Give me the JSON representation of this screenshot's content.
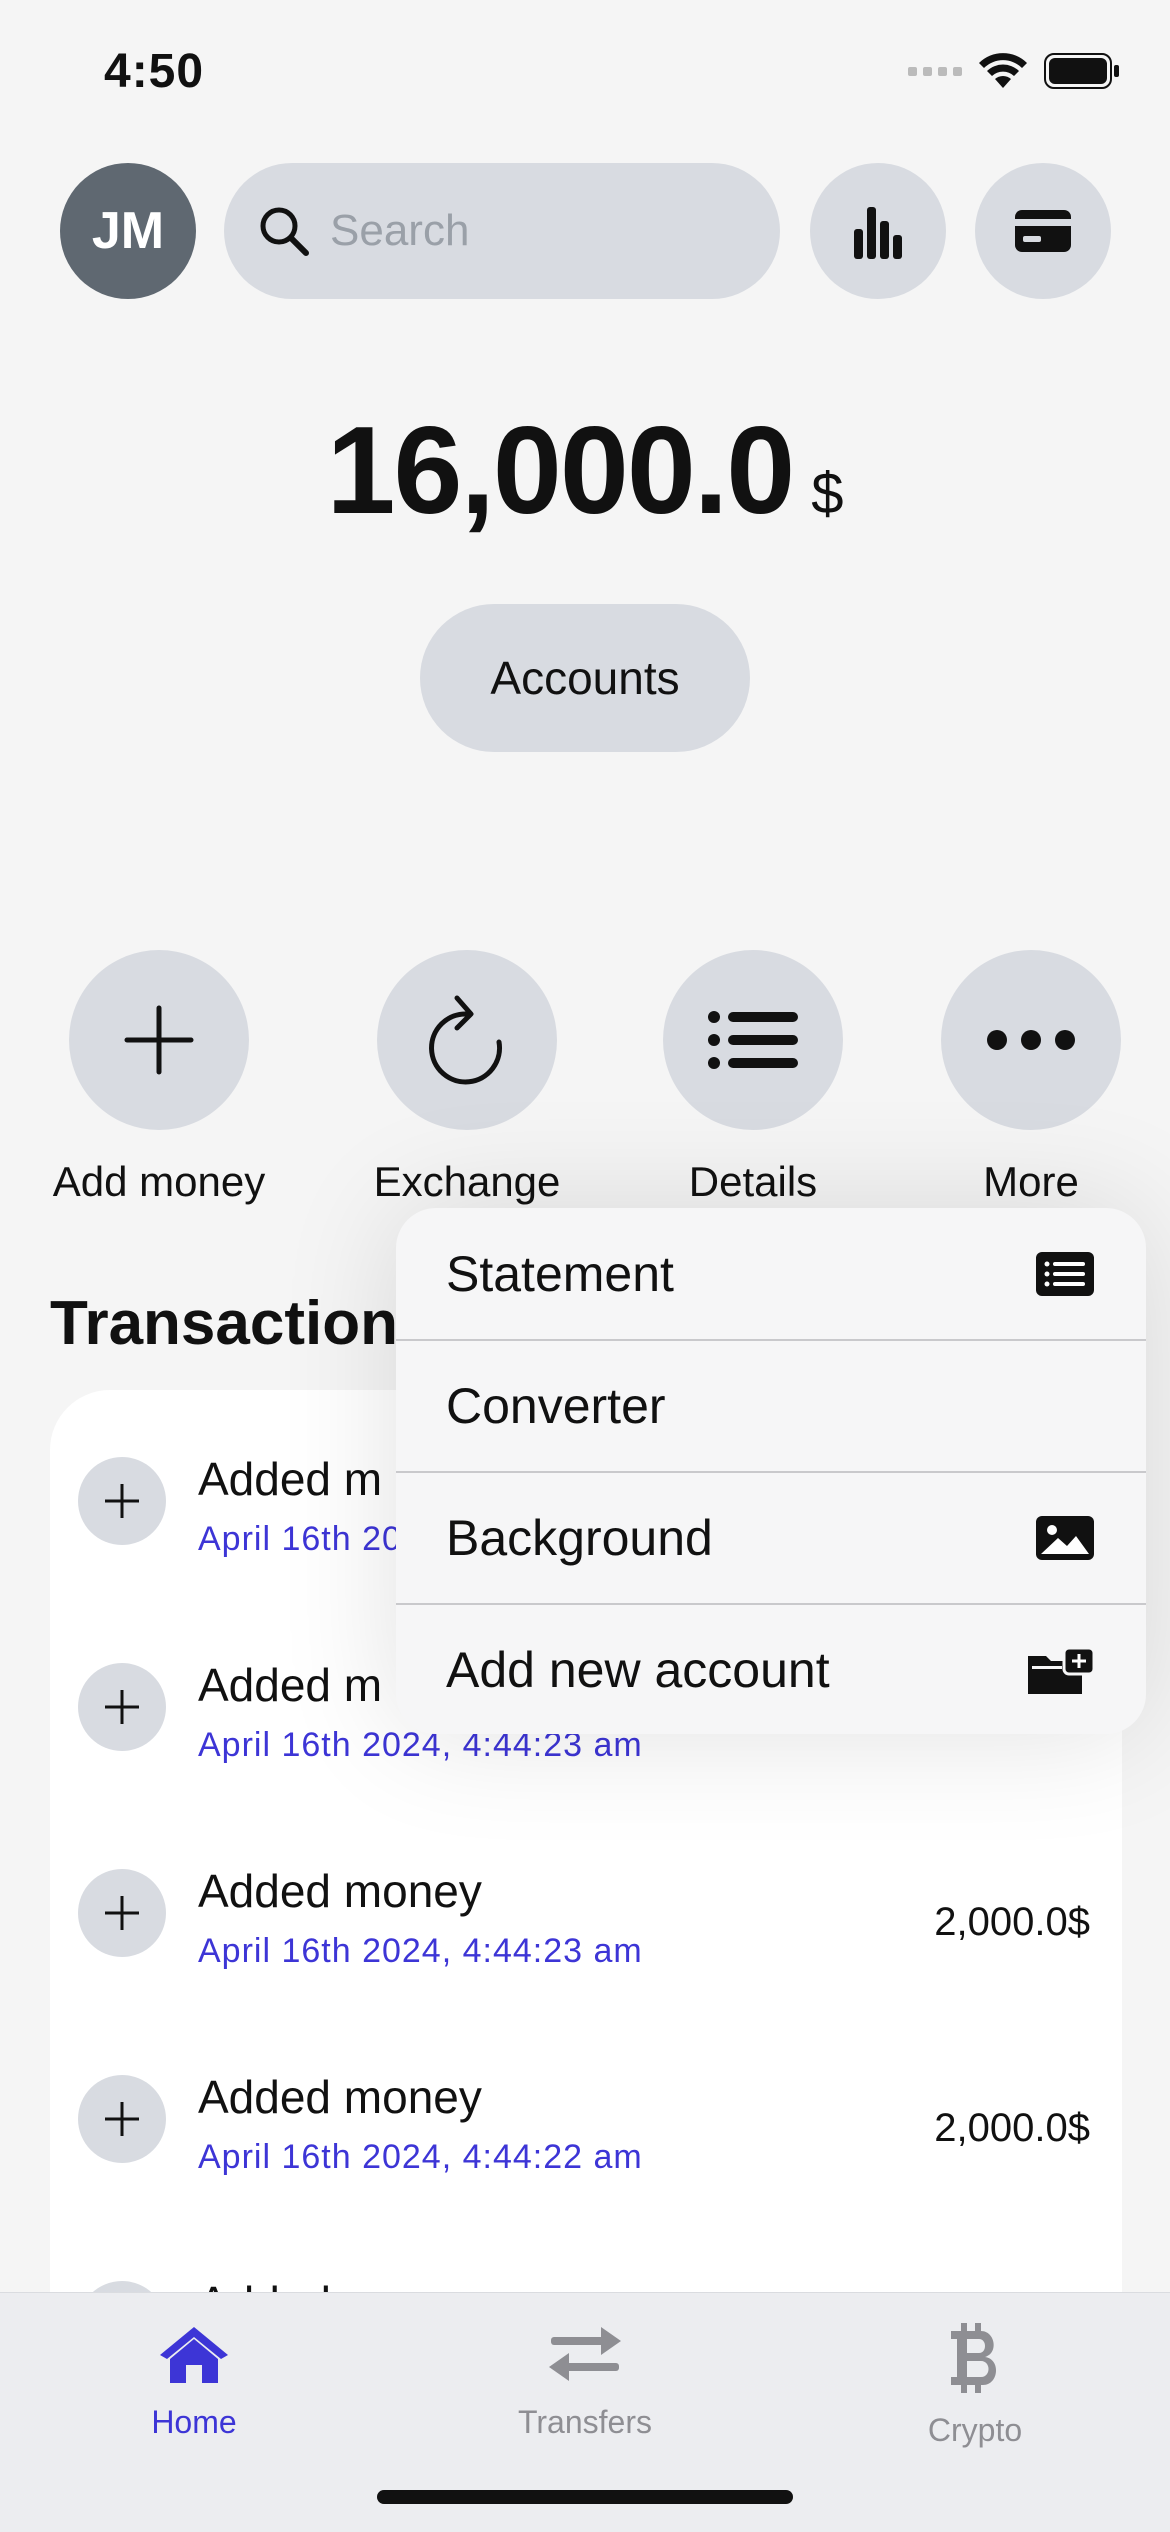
{
  "status_bar": {
    "time": "4:50"
  },
  "header": {
    "avatar_initials": "JM",
    "search_placeholder": "Search"
  },
  "balance": {
    "amount": "16,000.0",
    "currency": "$"
  },
  "accounts_label": "Accounts",
  "actions": [
    {
      "label": "Add money",
      "icon": "plus-icon"
    },
    {
      "label": "Exchange",
      "icon": "refresh-icon"
    },
    {
      "label": "Details",
      "icon": "list-icon"
    },
    {
      "label": "More",
      "icon": "ellipsis-icon"
    }
  ],
  "transactions": {
    "title": "Transactions",
    "items": [
      {
        "name": "Added m",
        "date": "April 16th 20",
        "amount": ""
      },
      {
        "name": "Added m",
        "date": "April 16th 2024, 4:44:23 am",
        "amount": ""
      },
      {
        "name": "Added money",
        "date": "April 16th 2024, 4:44:23 am",
        "amount": "2,000.0$"
      },
      {
        "name": "Added money",
        "date": "April 16th 2024, 4:44:22 am",
        "amount": "2,000.0$"
      },
      {
        "name": "Added money",
        "date": "",
        "amount": ""
      }
    ]
  },
  "menu": {
    "items": [
      {
        "label": "Statement",
        "icon": "statement-icon"
      },
      {
        "label": "Converter",
        "icon": ""
      },
      {
        "label": "Background",
        "icon": "image-icon"
      },
      {
        "label": "Add new account",
        "icon": "add-folder-icon"
      }
    ]
  },
  "tabbar": {
    "tabs": [
      {
        "label": "Home",
        "icon": "home-icon",
        "active": true
      },
      {
        "label": "Transfers",
        "icon": "transfer-arrows-icon",
        "active": false
      },
      {
        "label": "Crypto",
        "icon": "bitcoin-icon",
        "active": false
      }
    ]
  },
  "colors": {
    "accent": "#3d35d6",
    "inactive_tab": "#8e8e93",
    "avatar_bg": "#5f6871",
    "button_bg": "#d8dbe1"
  }
}
